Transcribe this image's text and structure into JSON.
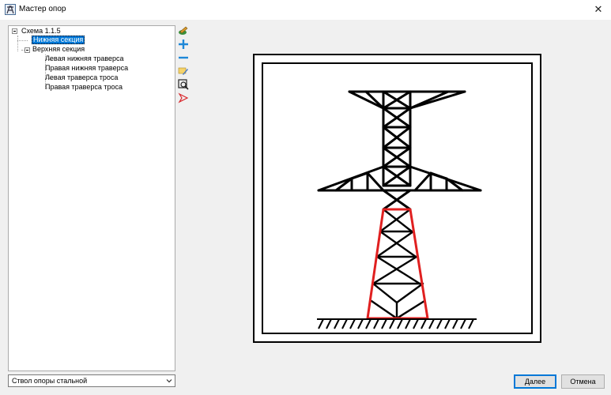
{
  "window": {
    "title": "Мастер опор",
    "close_glyph": "✕",
    "app_icon": "pylon-app-icon"
  },
  "tree": {
    "root": "Схема 1.1.5",
    "lower_section": "Нижняя секция",
    "upper_section": "Верхняя секция",
    "upper_children": [
      "Левая нижняя траверса",
      "Правая нижняя траверса",
      "Левая траверса троса",
      "Правая траверса троса"
    ],
    "selected": "Нижняя секция"
  },
  "toolbar": {
    "icons": [
      "edit-scheme-icon",
      "add-icon",
      "remove-icon",
      "rename-icon",
      "zoom-fit-icon",
      "delete-arrow-icon"
    ]
  },
  "section_type": {
    "selected_value": "Ствол опоры стальной"
  },
  "buttons": {
    "next_label": "Далее",
    "cancel_label": "Отмена"
  },
  "drawing": {
    "tower_color": "#000000",
    "highlight_color": "#e02020",
    "highlighted_part": "Нижняя секция"
  }
}
